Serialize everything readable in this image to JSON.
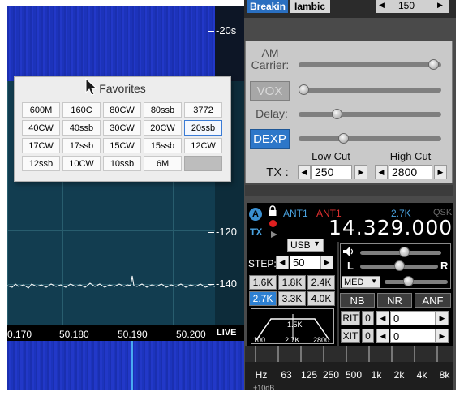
{
  "spectrum": {
    "db_labels": [
      "-20s",
      "-120",
      "-140"
    ],
    "freq_ticks": [
      "0.170",
      "50.180",
      "50.190",
      "50.200"
    ],
    "live_label": "LIVE"
  },
  "favorites": {
    "title": "Favorites",
    "buttons": [
      "600M",
      "160C",
      "80CW",
      "80ssb",
      "3772",
      "40CW",
      "40ssb",
      "30CW",
      "20CW",
      "20ssb",
      "17CW",
      "17ssb",
      "15CW",
      "15ssb",
      "12CW",
      "12ssb",
      "10CW",
      "10ssb",
      "6M",
      ""
    ],
    "selected": "20ssb"
  },
  "top_strip": {
    "breakin": "Breakin",
    "iambic": "Iambic",
    "value": "150"
  },
  "tx_panel": {
    "am_carrier_label": "AM\nCarrier:",
    "vox_label": "VOX",
    "delay_label": "Delay:",
    "dexp_label": "DEXP",
    "low_cut_label": "Low Cut",
    "high_cut_label": "High Cut",
    "tx_label": "TX :",
    "low_cut_value": "250",
    "high_cut_value": "2800",
    "am_carrier_level": 0.98,
    "vox_level": 0.0,
    "delay_level": 0.25,
    "dexp_level": 0.3
  },
  "vfo": {
    "badge": "A",
    "tx_badge": "TX",
    "ant_rx": "ANT1",
    "ant_tx": "ANT1",
    "filter_width": "2.7K",
    "qsk": "QSK",
    "frequency": "14.329.000",
    "mode": "USB",
    "step_label": "STEP:",
    "step_value": "50",
    "filters": [
      "1.6K",
      "1.8K",
      "2.4K",
      "2.7K",
      "3.3K",
      "4.0K"
    ],
    "active_filter": "2.7K",
    "filter_diagram": {
      "center": "1.5K",
      "low": "100",
      "mid": "2.7K",
      "high": "2800"
    },
    "audio": {
      "l_label": "L",
      "r_label": "R",
      "agc": "MED",
      "volume_level": 0.55,
      "pan_level": 0.5,
      "agc_level": 0.35
    },
    "dsp_buttons": [
      "NB",
      "NR",
      "ANF"
    ],
    "rit_label": "RIT",
    "rit_state": "0",
    "rit_value": "0",
    "xit_label": "XIT",
    "xit_state": "0",
    "xit_value": "0"
  },
  "eq": {
    "labels": [
      "Hz",
      "63",
      "125",
      "250",
      "500",
      "1k",
      "2k",
      "4k",
      "8k"
    ],
    "db_label": "+10dB"
  },
  "colors": {
    "accent_blue": "#2d80d2",
    "ant_tx_red": "#e03030",
    "panadapter_bg": "#123d50",
    "waterfall_blue": "#1f35c0"
  }
}
